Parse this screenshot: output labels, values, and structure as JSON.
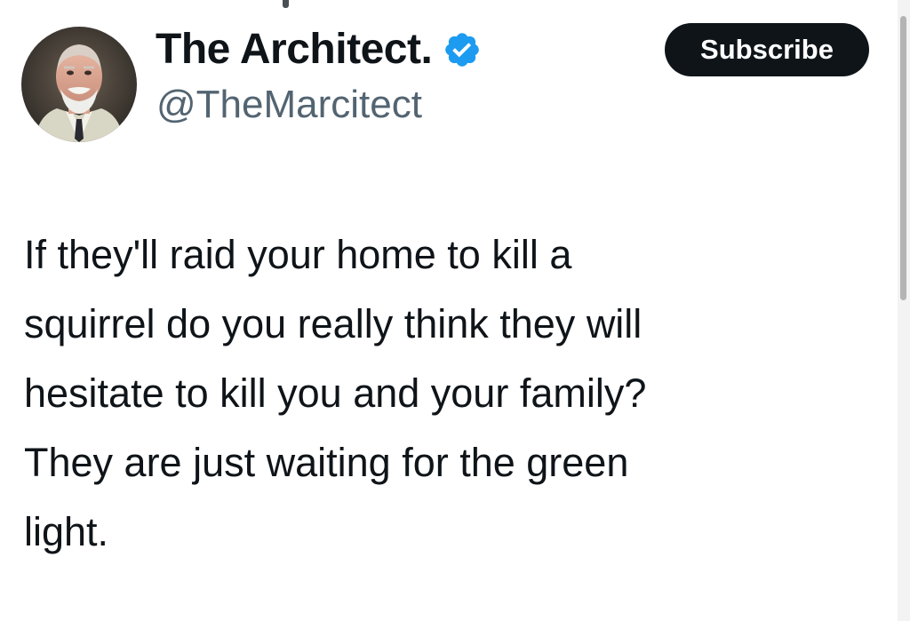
{
  "author": {
    "display_name": "The Architect.",
    "handle": "@TheMarcitect",
    "verified": true,
    "verified_icon": "verified-badge-icon",
    "avatar_icon": "profile-photo",
    "accent_color": "#1d9bf0"
  },
  "actions": {
    "subscribe_label": "Subscribe"
  },
  "tweet": {
    "lines": [
      "If they'll raid your home to kill a",
      "squirrel do you really think they will",
      "hesitate to kill you and your family?",
      "They are just waiting for the green",
      "light."
    ]
  },
  "colors": {
    "text_primary": "#0f1419",
    "text_secondary": "#536471",
    "button_bg": "#0f1419",
    "button_text": "#ffffff"
  }
}
